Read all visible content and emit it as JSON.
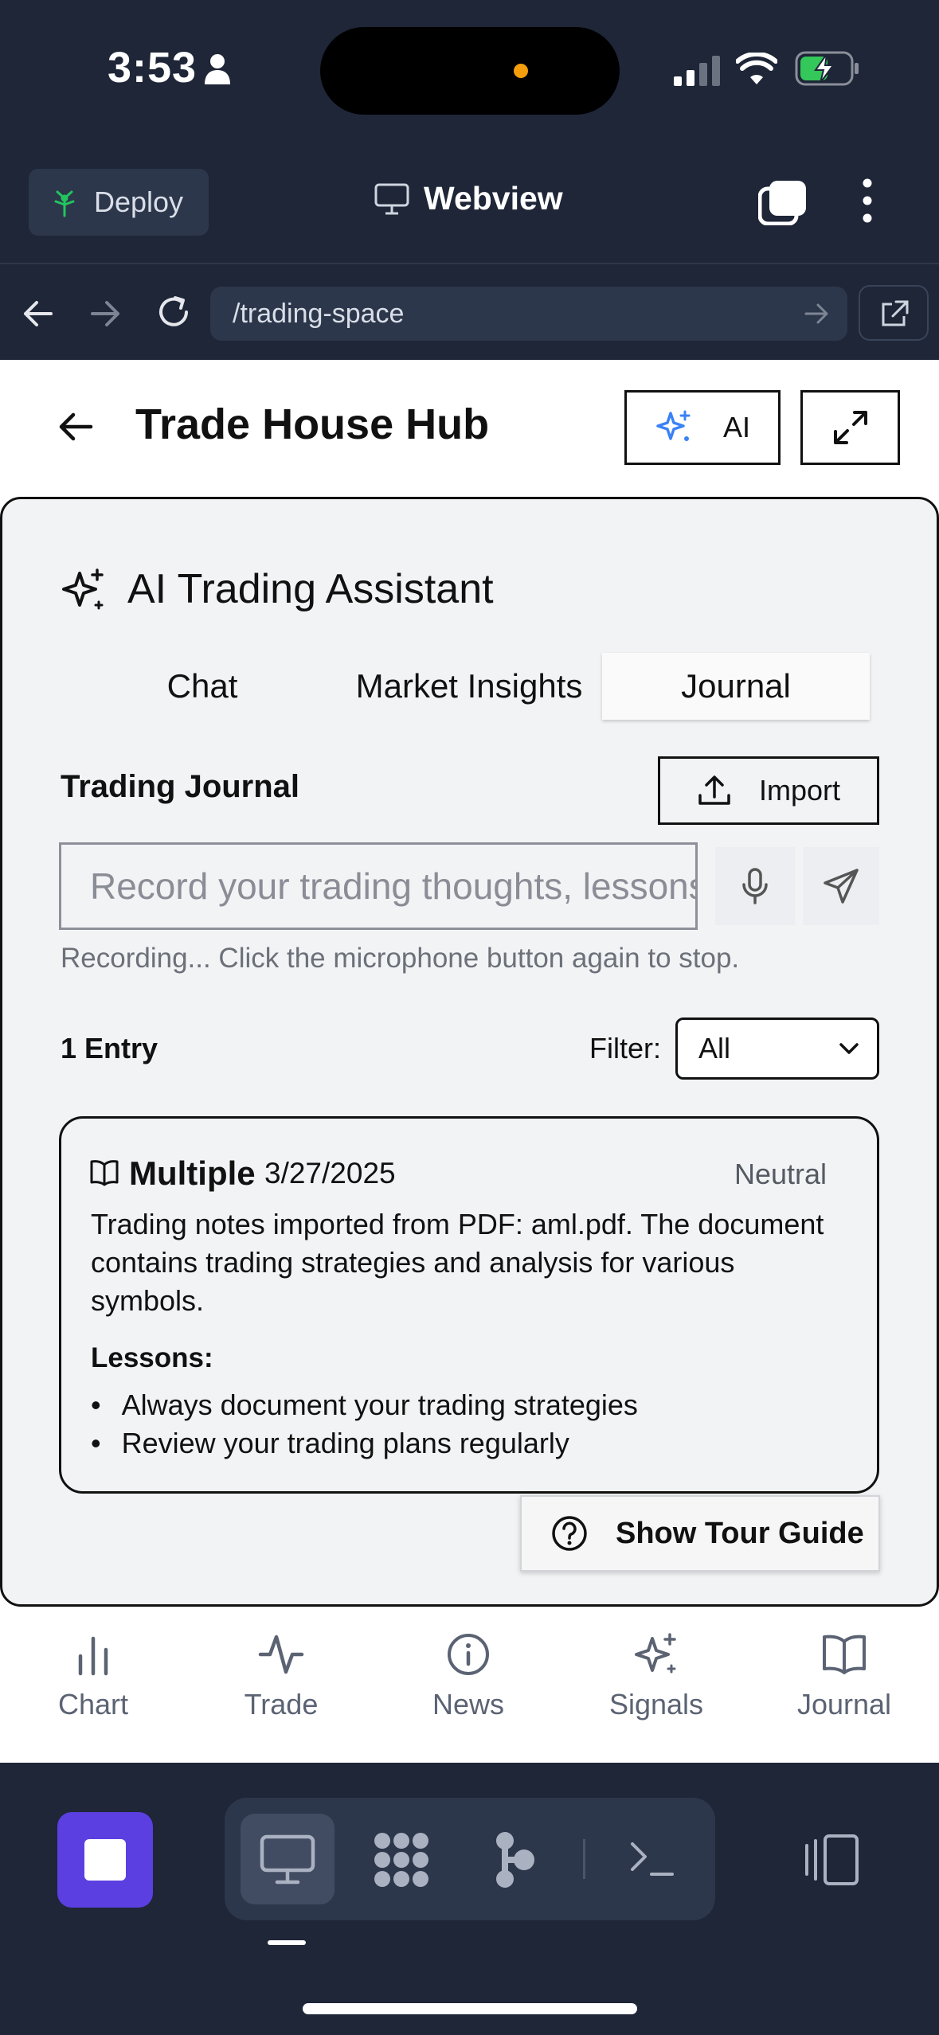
{
  "status_bar": {
    "time": "3:53"
  },
  "replit_header": {
    "deploy_label": "Deploy",
    "webview_label": "Webview"
  },
  "url_bar": {
    "url": "/trading-space"
  },
  "app_header": {
    "title": "Trade House Hub",
    "ai_label": "AI"
  },
  "assistant": {
    "title": "AI Trading Assistant",
    "tabs": [
      {
        "label": "Chat",
        "active": false
      },
      {
        "label": "Market Insights",
        "active": false
      },
      {
        "label": "Journal",
        "active": true
      }
    ],
    "journal": {
      "heading": "Trading Journal",
      "import_label": "Import",
      "input_placeholder": "Record your trading thoughts, lessons",
      "recording_note": "Recording... Click the microphone button again to stop.",
      "entry_count": "1 Entry",
      "filter_label": "Filter:",
      "filter_value": "All",
      "entries": [
        {
          "symbol": "Multiple",
          "date": "3/27/2025",
          "sentiment": "Neutral",
          "body": "Trading notes imported from PDF: aml.pdf. The document contains trading strategies and analysis for various symbols.",
          "lessons_label": "Lessons:",
          "lessons": [
            "Always document your trading strategies",
            "Review your trading plans regularly"
          ]
        }
      ]
    },
    "tour_label": "Show Tour Guide"
  },
  "bottom_nav": [
    {
      "label": "Chart",
      "icon": "bar-chart-icon"
    },
    {
      "label": "Trade",
      "icon": "activity-icon"
    },
    {
      "label": "News",
      "icon": "info-icon"
    },
    {
      "label": "Signals",
      "icon": "sparkles-icon"
    },
    {
      "label": "Journal",
      "icon": "book-open-icon"
    }
  ],
  "colors": {
    "chrome_bg": "#1e2638",
    "accent_purple": "#5b3fe0",
    "sparkle_blue": "#3b82f6",
    "deploy_green": "#22c55e"
  }
}
